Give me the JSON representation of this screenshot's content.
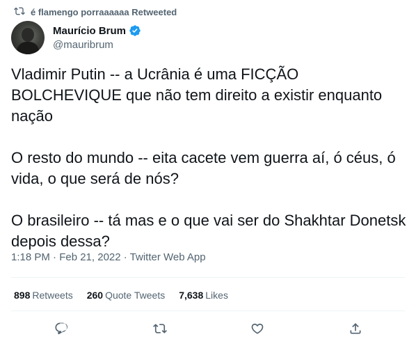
{
  "retweet_context": {
    "text": "é flamengo porraaaaaa Retweeted",
    "icon": "retweet-icon"
  },
  "author": {
    "display_name": "Maurício Brum",
    "handle": "@mauribrum",
    "verified": true,
    "verified_color": "#1d9bf0"
  },
  "tweet": {
    "paragraphs": [
      "Vladimir Putin -- a Ucrânia é uma FICÇÃO BOLCHEVIQUE que não tem direito a existir enquanto nação",
      "O resto do mundo -- eita cacete vem guerra aí, ó céus, ó vida, o que será de nós?",
      "O brasileiro -- tá mas e o que vai ser do Shakhtar Donetsk depois dessa?"
    ],
    "timestamp": "1:18 PM · Feb 21, 2022 · Twitter Web App"
  },
  "stats": {
    "retweets_count": "898",
    "retweets_label": "Retweets",
    "quote_count": "260",
    "quote_label": "Quote Tweets",
    "likes_count": "7,638",
    "likes_label": "Likes"
  },
  "actions": [
    {
      "name": "reply",
      "icon": "reply-icon"
    },
    {
      "name": "retweet",
      "icon": "retweet-icon"
    },
    {
      "name": "like",
      "icon": "heart-icon"
    },
    {
      "name": "share",
      "icon": "share-icon"
    }
  ],
  "colors": {
    "text": "#0f1419",
    "secondary": "#536471",
    "accent": "#1d9bf0"
  }
}
